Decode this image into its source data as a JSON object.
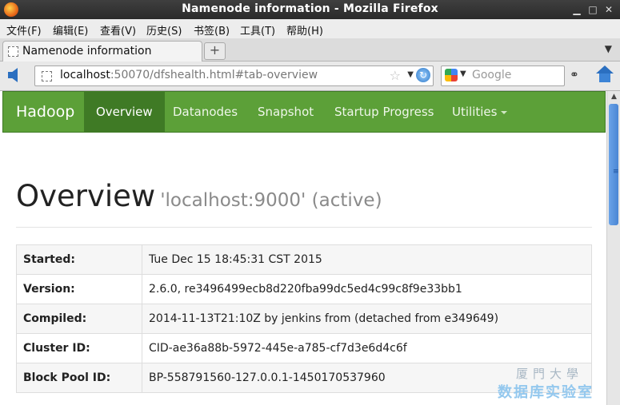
{
  "window": {
    "title": "Namenode information - Mozilla Firefox"
  },
  "menu": [
    "文件(F)",
    "编辑(E)",
    "查看(V)",
    "历史(S)",
    "书签(B)",
    "工具(T)",
    "帮助(H)"
  ],
  "tab": {
    "label": "Namenode information"
  },
  "address": {
    "host": "localhost",
    "rest": ":50070/dfshealth.html#tab-overview"
  },
  "search": {
    "placeholder": "Google"
  },
  "hadoop_nav": {
    "brand": "Hadoop",
    "items": [
      "Overview",
      "Datanodes",
      "Snapshot",
      "Startup Progress",
      "Utilities"
    ],
    "active": "Overview"
  },
  "page": {
    "heading": "Overview",
    "subheading": "'localhost:9000' (active)"
  },
  "overview_table": [
    {
      "key": "Started:",
      "value": "Tue Dec 15 18:45:31 CST 2015"
    },
    {
      "key": "Version:",
      "value": "2.6.0, re3496499ecb8d220fba99dc5ed4c99c8f9e33bb1"
    },
    {
      "key": "Compiled:",
      "value": "2014-11-13T21:10Z by jenkins from (detached from e349649)"
    },
    {
      "key": "Cluster ID:",
      "value": "CID-ae36a88b-5972-445e-a785-cf7d3e6d4c6f"
    },
    {
      "key": "Block Pool ID:",
      "value": "BP-558791560-127.0.0.1-1450170537960"
    }
  ],
  "watermark": {
    "line1": "厦門大學",
    "line2": "数据库实验室"
  },
  "colors": {
    "nav_green": "#5ca038",
    "nav_active": "#3f7a25"
  },
  "icons": [
    "firefox-icon",
    "minimize-icon",
    "maximize-icon",
    "close-icon",
    "back-arrow-icon",
    "bookmark-star-icon",
    "reload-icon",
    "google-icon",
    "binoculars-icon",
    "home-icon"
  ]
}
